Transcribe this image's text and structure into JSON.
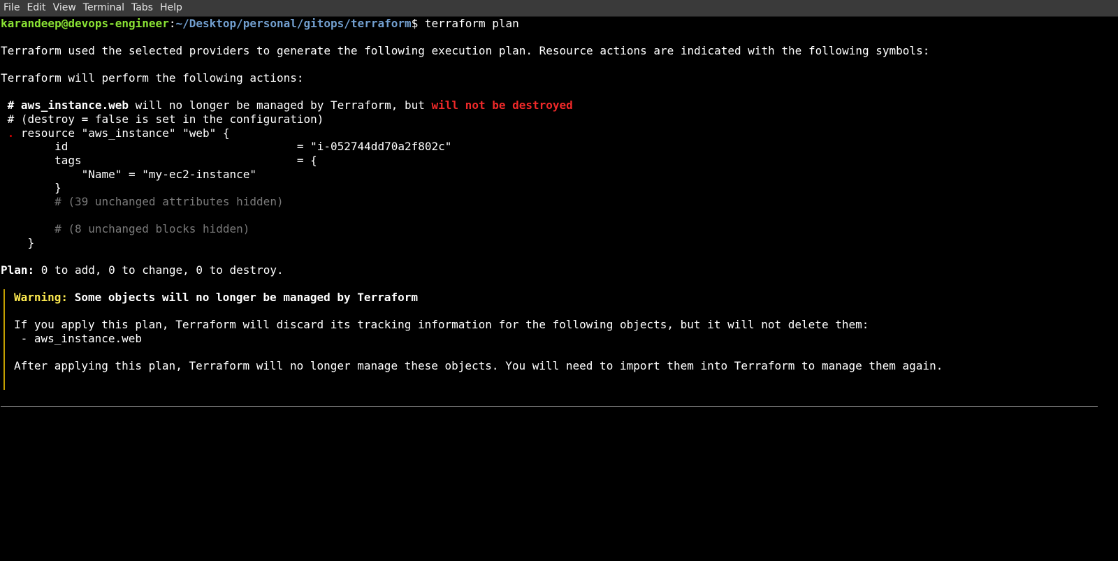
{
  "menu": {
    "file": "File",
    "edit": "Edit",
    "view": "View",
    "terminal": "Terminal",
    "tabs": "Tabs",
    "help": "Help"
  },
  "prompt": {
    "user_host": "karandeep@devops-engineer",
    "colon": ":",
    "path": "~/Desktop/personal/gitops/terraform",
    "dollar": "$",
    "command": " terraform plan"
  },
  "output": {
    "intro": "Terraform used the selected providers to generate the following execution plan. Resource actions are indicated with the following symbols:",
    "actions": "Terraform will perform the following actions:",
    "comment_hash": " # ",
    "resource_address": "aws_instance.web",
    "no_longer_managed": " will no longer be managed by Terraform, but ",
    "not_destroyed": "will not be destroyed",
    "destroy_comment": " # (destroy = false is set in the configuration)",
    "forget_symbol": " .",
    "resource_decl": " resource \"aws_instance\" \"web\" {",
    "id_line": "        id                                  = \"i-052744dd70a2f802c\"",
    "tags_line": "        tags                                = {",
    "name_tag_line": "            \"Name\" = \"my-ec2-instance\"",
    "tags_close": "        }",
    "unchanged_attrs": "        # (39 unchanged attributes hidden)",
    "unchanged_blocks": "        # (8 unchanged blocks hidden)",
    "resource_close": "    }",
    "plan_label": "Plan:",
    "plan_summary": " 0 to add, 0 to change, 0 to destroy."
  },
  "warning": {
    "label": "Warning:",
    "title": " Some objects will no longer be managed by Terraform",
    "body1": "If you apply this plan, Terraform will discard its tracking information for the following objects, but it will not delete them:",
    "item": " - aws_instance.web",
    "body2": "After applying this plan, Terraform will no longer manage these objects. You will need to import them into Terraform to manage them again."
  },
  "colors": {
    "background": "#000000",
    "prompt_user": "#8ae234",
    "prompt_path": "#729fcf",
    "error_red": "#ef2929",
    "warning_yellow": "#fce94f",
    "dim_comment": "#7a7a7a"
  }
}
